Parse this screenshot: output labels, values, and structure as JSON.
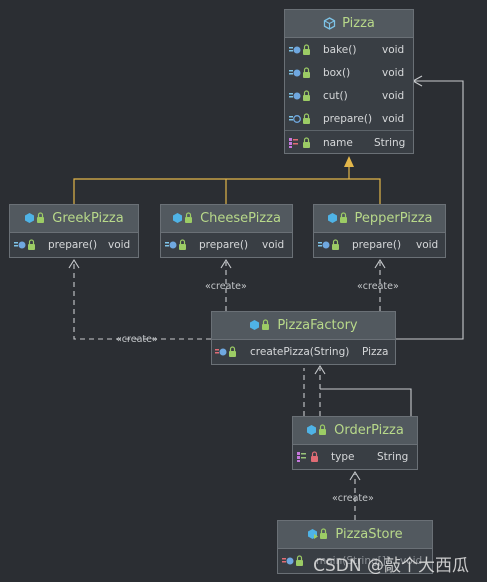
{
  "classes": {
    "pizza": {
      "name": "Pizza",
      "methods": [
        {
          "name": "bake()",
          "type": "void"
        },
        {
          "name": "box()",
          "type": "void"
        },
        {
          "name": "cut()",
          "type": "void"
        },
        {
          "name": "prepare()",
          "type": "void"
        }
      ],
      "fields": [
        {
          "name": "name",
          "type": "String"
        }
      ]
    },
    "greek": {
      "name": "GreekPizza",
      "methods": [
        {
          "name": "prepare()",
          "type": "void"
        }
      ]
    },
    "cheese": {
      "name": "CheesePizza",
      "methods": [
        {
          "name": "prepare()",
          "type": "void"
        }
      ]
    },
    "pepper": {
      "name": "PepperPizza",
      "methods": [
        {
          "name": "prepare()",
          "type": "void"
        }
      ]
    },
    "factory": {
      "name": "PizzaFactory",
      "methods": [
        {
          "name": "createPizza(String)",
          "type": "Pizza"
        }
      ]
    },
    "order": {
      "name": "OrderPizza",
      "fields": [
        {
          "name": "type",
          "type": "String"
        }
      ]
    },
    "store": {
      "name": "PizzaStore",
      "methods": [
        {
          "name": "main(String[])",
          "type": "void"
        }
      ]
    }
  },
  "relations": {
    "create_label": "«create»"
  },
  "watermark": "CSDN @敲个大西瓜",
  "colors": {
    "background": "#2b2e33",
    "header": "#52595f",
    "body": "#393e44",
    "title": "#b8d98a",
    "inheritance": "#e2b64a",
    "dependency": "#c8cbce"
  }
}
